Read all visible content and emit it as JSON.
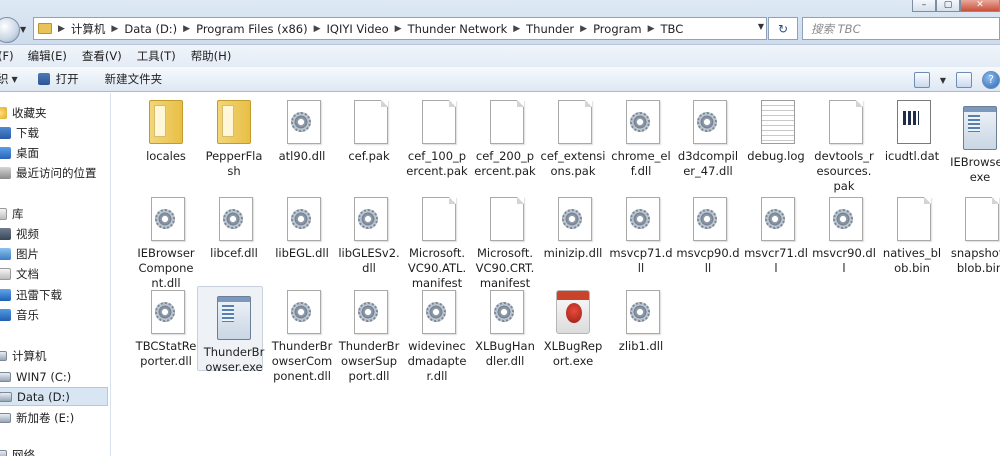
{
  "window": {
    "buttons": [
      "–",
      "▢",
      "✕"
    ]
  },
  "address_bar": {
    "crumbs": [
      "计算机",
      "Data (D:)",
      "Program Files (x86)",
      "IQIYI Video",
      "Thunder Network",
      "Thunder",
      "Program",
      "TBC"
    ],
    "separator": "▶"
  },
  "search": {
    "placeholder": "搜索 TBC"
  },
  "menubar": {
    "items": [
      "(F)",
      "编辑(E)",
      "查看(V)",
      "工具(T)",
      "帮助(H)"
    ]
  },
  "toolbar": {
    "first_label": "织",
    "open_label": "打开",
    "new_folder_label": "新建文件夹",
    "help_glyph": "?"
  },
  "sidebar": {
    "favorites_header": "收藏夹",
    "favorites": [
      "下载",
      "桌面",
      "最近访问的位置"
    ],
    "library_header": "库",
    "libraries": [
      "视频",
      "图片",
      "文档",
      "迅雷下载",
      "音乐"
    ],
    "computer_header": "计算机",
    "drives": [
      "WIN7 (C:)",
      "Data (D:)",
      "新加卷 (E:)"
    ],
    "bottom_partial": "网络"
  },
  "files": [
    {
      "name": "locales",
      "type": "folder"
    },
    {
      "name": "PepperFlash",
      "type": "folder"
    },
    {
      "name": "atl90.dll",
      "type": "dll"
    },
    {
      "name": "cef.pak",
      "type": "page"
    },
    {
      "name": "cef_100_percent.pak",
      "type": "page"
    },
    {
      "name": "cef_200_percent.pak",
      "type": "page"
    },
    {
      "name": "cef_extensions.pak",
      "type": "page"
    },
    {
      "name": "chrome_elf.dll",
      "type": "dll"
    },
    {
      "name": "d3dcompiler_47.dll",
      "type": "dll"
    },
    {
      "name": "debug.log",
      "type": "log"
    },
    {
      "name": "devtools_resources.pak",
      "type": "page"
    },
    {
      "name": "icudtl.dat",
      "type": "dat"
    },
    {
      "name": "IEBrowser.exe",
      "type": "exe"
    },
    {
      "name": "IEBrowserComponent.dll",
      "type": "dll"
    },
    {
      "name": "libcef.dll",
      "type": "dll"
    },
    {
      "name": "libEGL.dll",
      "type": "dll"
    },
    {
      "name": "libGLESv2.dll",
      "type": "dll"
    },
    {
      "name": "Microsoft.VC90.ATL.manifest",
      "type": "page"
    },
    {
      "name": "Microsoft.VC90.CRT.manifest",
      "type": "page"
    },
    {
      "name": "minizip.dll",
      "type": "dll"
    },
    {
      "name": "msvcp71.dll",
      "type": "dll"
    },
    {
      "name": "msvcp90.dll",
      "type": "dll"
    },
    {
      "name": "msvcr71.dll",
      "type": "dll"
    },
    {
      "name": "msvcr90.dll",
      "type": "dll"
    },
    {
      "name": "natives_blob.bin",
      "type": "page"
    },
    {
      "name": "snapshot_blob.bin",
      "type": "page"
    },
    {
      "name": "TBCStatReporter.dll",
      "type": "dll"
    },
    {
      "name": "ThunderBrowser.exe",
      "type": "exe",
      "selected": true
    },
    {
      "name": "ThunderBrowserComponent.dll",
      "type": "dll"
    },
    {
      "name": "ThunderBrowserSupport.dll",
      "type": "dll"
    },
    {
      "name": "widevinecdmadapter.dll",
      "type": "dll"
    },
    {
      "name": "XLBugHandler.dll",
      "type": "dll"
    },
    {
      "name": "XLBugReport.exe",
      "type": "bug"
    },
    {
      "name": "zlib1.dll",
      "type": "dll"
    }
  ],
  "name_lines": [
    [
      "locales"
    ],
    [
      "PepperFla",
      "sh"
    ],
    [
      "atl90.dll"
    ],
    [
      "cef.pak"
    ],
    [
      "cef_100_p",
      "ercent.pak"
    ],
    [
      "cef_200_p",
      "ercent.pak"
    ],
    [
      "cef_extensi",
      "ons.pak"
    ],
    [
      "chrome_el",
      "f.dll"
    ],
    [
      "d3dcompil",
      "er_47.dll"
    ],
    [
      "debug.log"
    ],
    [
      "devtools_r",
      "esources.",
      "pak"
    ],
    [
      "icudtl.dat"
    ],
    [
      "IEBrowser.",
      "exe"
    ],
    [
      "IEBrowser",
      "Compone",
      "nt.dll"
    ],
    [
      "libcef.dll"
    ],
    [
      "libEGL.dll"
    ],
    [
      "libGLESv2.",
      "dll"
    ],
    [
      "Microsoft.",
      "VC90.ATL.",
      "manifest"
    ],
    [
      "Microsoft.",
      "VC90.CRT.",
      "manifest"
    ],
    [
      "minizip.dll"
    ],
    [
      "msvcp71.d",
      "ll"
    ],
    [
      "msvcp90.d",
      "ll"
    ],
    [
      "msvcr71.dl",
      "l"
    ],
    [
      "msvcr90.dl",
      "l"
    ],
    [
      "natives_bl",
      "ob.bin"
    ],
    [
      "snapshot_",
      "blob.bin"
    ],
    [
      "TBCStatRe",
      "porter.dll"
    ],
    [
      "ThunderBr",
      "owser.exe"
    ],
    [
      "ThunderBr",
      "owserCom",
      "ponent.dll"
    ],
    [
      "ThunderBr",
      "owserSup",
      "port.dll"
    ],
    [
      "widevinec",
      "dmadapte",
      "r.dll"
    ],
    [
      "XLBugHan",
      "dler.dll"
    ],
    [
      "XLBugRep",
      "ort.exe"
    ],
    [
      "zlib1.dll"
    ]
  ]
}
